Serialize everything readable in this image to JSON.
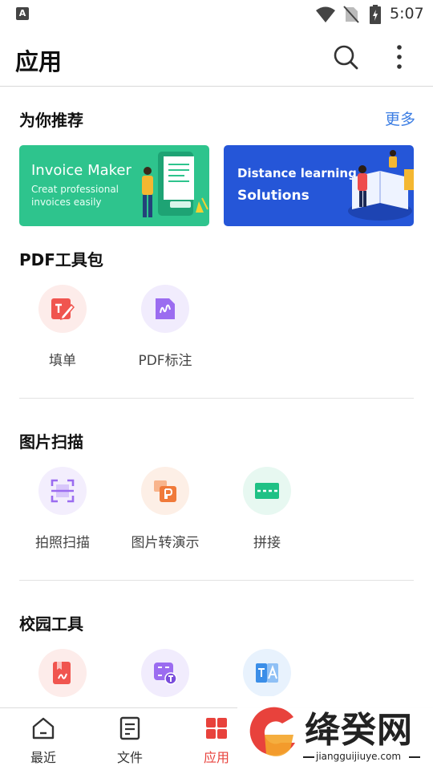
{
  "status_bar": {
    "time": "5:07",
    "notification_icon": "A"
  },
  "app_bar": {
    "title": "应用",
    "search_icon": "search-icon",
    "more_icon": "more-vert-icon"
  },
  "recommend": {
    "title": "为你推荐",
    "more_label": "更多",
    "banners": [
      {
        "title": "Invoice Maker",
        "subtitle_line1": "Creat professional",
        "subtitle_line2": "invoices easily",
        "color": "#2ec48d"
      },
      {
        "title": "Distance learning",
        "subtitle_line1": "Solutions",
        "color": "#2556d8"
      }
    ]
  },
  "pdf_tools": {
    "title": "PDF工具包",
    "items": [
      {
        "label": "填单",
        "icon": "fill-form-icon",
        "color": "#f0554f",
        "bg": "#fdecea"
      },
      {
        "label": "PDF标注",
        "icon": "pdf-annotate-icon",
        "color": "#9b6cf0",
        "bg": "#f1ecfd"
      }
    ]
  },
  "image_scan": {
    "title": "图片扫描",
    "items": [
      {
        "label": "拍照扫描",
        "icon": "photo-scan-icon",
        "color": "#9b6cf0",
        "bg": "#f3eefd"
      },
      {
        "label": "图片转演示",
        "icon": "image-to-slides-icon",
        "color": "#f07a3a",
        "bg": "#fdefe6"
      },
      {
        "label": "拼接",
        "icon": "stitch-icon",
        "color": "#1fc185",
        "bg": "#e7f8f1"
      }
    ]
  },
  "campus_tools": {
    "title": "校园工具",
    "items": [
      {
        "icon": "homework-icon",
        "color": "#f0554f",
        "bg": "#fdecea"
      },
      {
        "icon": "text-recognize-icon",
        "color": "#9b6cf0",
        "bg": "#f1ecfd"
      },
      {
        "icon": "translate-icon",
        "color": "#3b8ee8",
        "bg": "#e8f2fd"
      }
    ]
  },
  "bottom_nav": {
    "items": [
      {
        "label": "最近",
        "icon": "home-icon"
      },
      {
        "label": "文件",
        "icon": "document-icon"
      },
      {
        "label": "应用",
        "icon": "apps-grid-icon",
        "active": true
      }
    ],
    "active_color": "#e8423c"
  },
  "watermark": {
    "title": "绛癸网",
    "url": "jiangguijiuye.com"
  }
}
